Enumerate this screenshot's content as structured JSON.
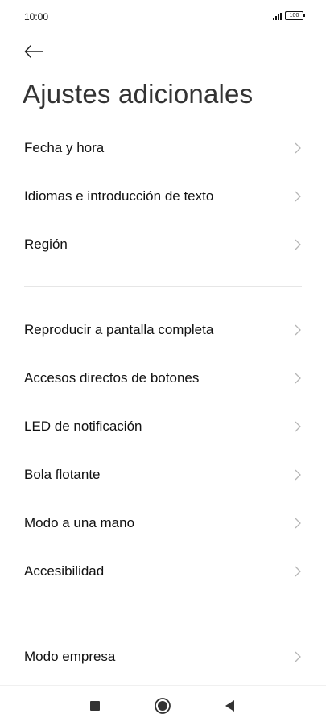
{
  "status_bar": {
    "time": "10:00",
    "battery": "100",
    "icons": [
      "signal-icon",
      "battery-icon"
    ]
  },
  "header": {
    "back_icon": "arrow-left-icon",
    "title": "Ajustes adicionales"
  },
  "menu": {
    "groups": [
      {
        "items": [
          {
            "label": "Fecha y hora"
          },
          {
            "label": "Idiomas e introducción de texto"
          },
          {
            "label": "Región"
          }
        ]
      },
      {
        "items": [
          {
            "label": "Reproducir a pantalla completa"
          },
          {
            "label": "Accesos directos de botones"
          },
          {
            "label": "LED de notificación"
          },
          {
            "label": "Bola flotante"
          },
          {
            "label": "Modo a una mano"
          },
          {
            "label": "Accesibilidad"
          }
        ]
      },
      {
        "items": [
          {
            "label": "Modo empresa"
          }
        ]
      }
    ],
    "chevron_icon": "chevron-right-icon"
  },
  "nav_bar": {
    "buttons": [
      "recents-square-icon",
      "home-circle-icon",
      "back-triangle-icon"
    ]
  },
  "colors": {
    "background": "#ffffff",
    "text": "#111111",
    "title": "#333333",
    "chevron": "#b5b5b5",
    "divider": "#e6e6e6"
  }
}
